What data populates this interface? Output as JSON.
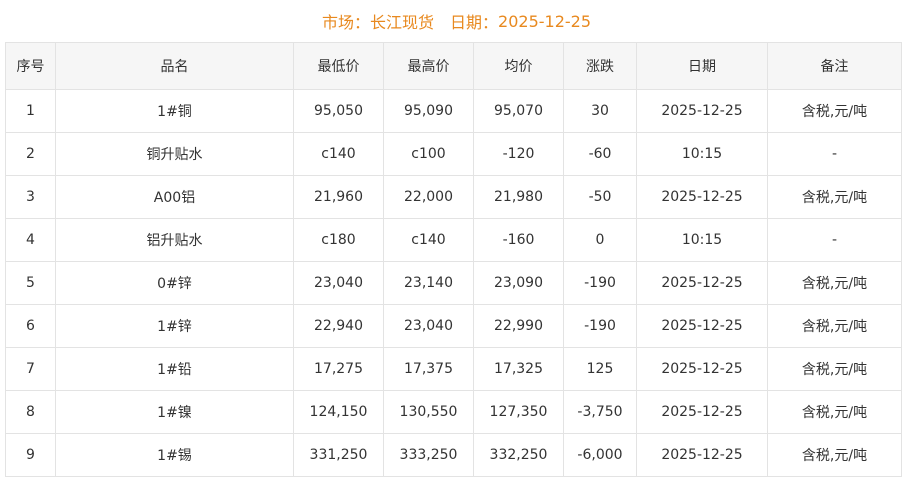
{
  "header": {
    "market_label": "市场：",
    "market_value": "长江现货",
    "date_label": "日期：",
    "date_value": "2025-12-25"
  },
  "colors": {
    "title": "#e8891f",
    "up": "#d9001b",
    "down": "#118811",
    "flat": "#b5b5b5",
    "header_bg": "#f6f6f6",
    "border": "#e3e3e3"
  },
  "table": {
    "columns": [
      "序号",
      "品名",
      "最低价",
      "最高价",
      "均价",
      "涨跌",
      "日期",
      "备注"
    ],
    "rows": [
      {
        "no": "1",
        "name": "1#铜",
        "low": "95,050",
        "high": "95,090",
        "avg": "95,070",
        "change": "30",
        "trend": "up",
        "date": "2025-12-25",
        "note": "含税,元/吨"
      },
      {
        "no": "2",
        "name": "铜升贴水",
        "low": "c140",
        "high": "c100",
        "avg": "-120",
        "change": "-60",
        "trend": "down",
        "date": "10:15",
        "note": "-"
      },
      {
        "no": "3",
        "name": "A00铝",
        "low": "21,960",
        "high": "22,000",
        "avg": "21,980",
        "change": "-50",
        "trend": "down",
        "date": "2025-12-25",
        "note": "含税,元/吨"
      },
      {
        "no": "4",
        "name": "铝升贴水",
        "low": "c180",
        "high": "c140",
        "avg": "-160",
        "change": "0",
        "trend": "flat",
        "date": "10:15",
        "note": "-"
      },
      {
        "no": "5",
        "name": "0#锌",
        "low": "23,040",
        "high": "23,140",
        "avg": "23,090",
        "change": "-190",
        "trend": "down",
        "date": "2025-12-25",
        "note": "含税,元/吨"
      },
      {
        "no": "6",
        "name": "1#锌",
        "low": "22,940",
        "high": "23,040",
        "avg": "22,990",
        "change": "-190",
        "trend": "down",
        "date": "2025-12-25",
        "note": "含税,元/吨"
      },
      {
        "no": "7",
        "name": "1#铅",
        "low": "17,275",
        "high": "17,375",
        "avg": "17,325",
        "change": "125",
        "trend": "up",
        "date": "2025-12-25",
        "note": "含税,元/吨"
      },
      {
        "no": "8",
        "name": "1#镍",
        "low": "124,150",
        "high": "130,550",
        "avg": "127,350",
        "change": "-3,750",
        "trend": "down",
        "date": "2025-12-25",
        "note": "含税,元/吨"
      },
      {
        "no": "9",
        "name": "1#锡",
        "low": "331,250",
        "high": "333,250",
        "avg": "332,250",
        "change": "-6,000",
        "trend": "down",
        "date": "2025-12-25",
        "note": "含税,元/吨"
      }
    ]
  }
}
